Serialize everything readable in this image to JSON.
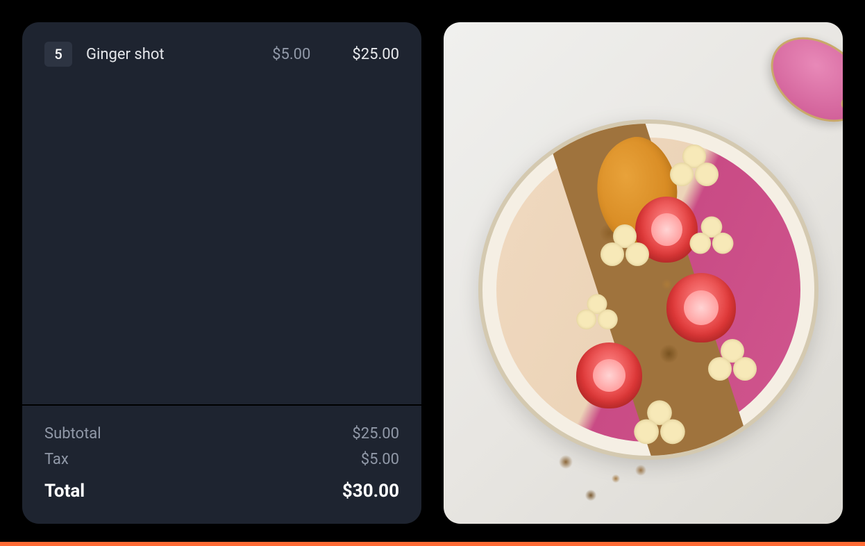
{
  "receipt": {
    "items": [
      {
        "qty": "5",
        "name": "Ginger shot",
        "unit_price": "$5.00",
        "line_total": "$25.00"
      }
    ],
    "summary": {
      "subtotal_label": "Subtotal",
      "subtotal_value": "$25.00",
      "tax_label": "Tax",
      "tax_value": "$5.00",
      "total_label": "Total",
      "total_value": "$30.00"
    }
  },
  "product_image": {
    "description": "smoothie-bowl-with-strawberries-banana-granola"
  },
  "colors": {
    "accent": "#ff6b35",
    "panel_bg": "#1e2430",
    "muted_text": "#9199a8"
  }
}
